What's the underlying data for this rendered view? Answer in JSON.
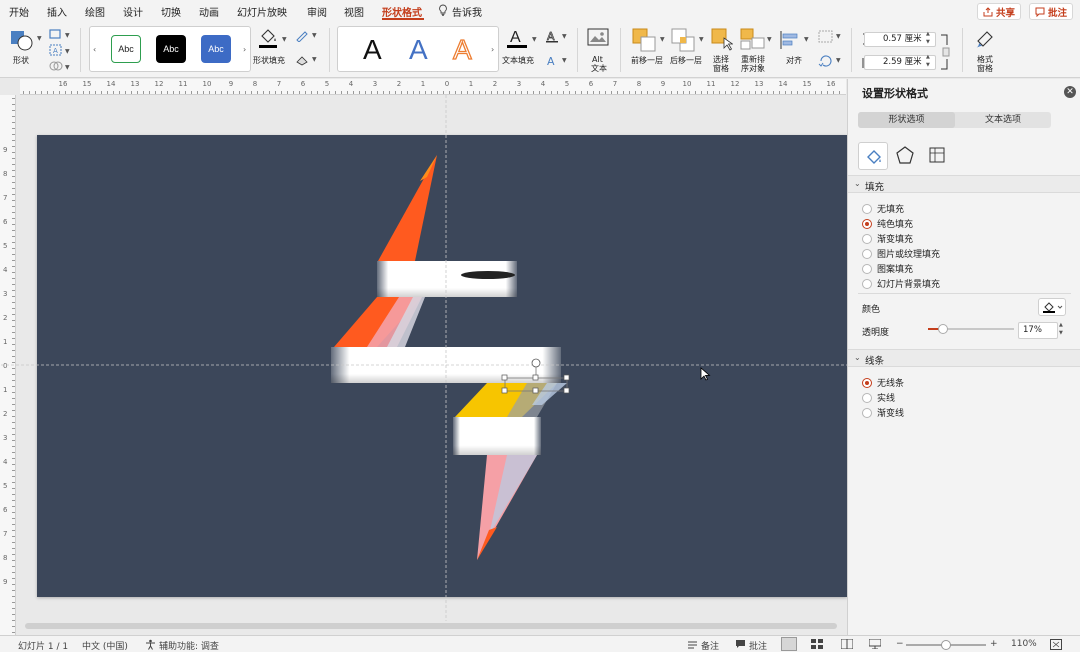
{
  "tabs": [
    {
      "label": "开始"
    },
    {
      "label": "插入"
    },
    {
      "label": "绘图"
    },
    {
      "label": "设计"
    },
    {
      "label": "切换"
    },
    {
      "label": "动画"
    },
    {
      "label": "幻灯片放映"
    },
    {
      "label": "审阅"
    },
    {
      "label": "视图"
    },
    {
      "label": "形状格式",
      "active": true
    },
    {
      "label": "告诉我"
    }
  ],
  "header": {
    "share_label": "共享",
    "comment_label": "批注"
  },
  "ribbon": {
    "shape_label": "形状",
    "style_swatches": [
      "Abc",
      "Abc",
      "Abc"
    ],
    "shape_fill_label": "形状填充",
    "wordart_letters": [
      "A",
      "A",
      "A"
    ],
    "text_fill_label": "文本填充",
    "alt_text_label_1": "Alt",
    "alt_text_label_2": "文本",
    "bring_forward_label": "前移一层",
    "send_backward_label": "后移一层",
    "selection_pane_label_1": "选择",
    "selection_pane_label_2": "窗格",
    "reorder_label_1": "重新排",
    "reorder_label_2": "序对象",
    "align_label": "对齐",
    "height_value": "0.57 厘米",
    "width_value": "2.59 厘米",
    "format_pane_label_1": "格式",
    "format_pane_label_2": "窗格"
  },
  "ruler": {
    "h_labels": [
      "16",
      "15",
      "14",
      "13",
      "12",
      "11",
      "10",
      "9",
      "8",
      "7",
      "6",
      "5",
      "4",
      "3",
      "2",
      "1",
      "0",
      "1",
      "2",
      "3",
      "4",
      "5",
      "6",
      "7",
      "8",
      "9",
      "10",
      "11",
      "12",
      "13",
      "14",
      "15",
      "16"
    ],
    "v_labels": [
      "9",
      "8",
      "7",
      "6",
      "5",
      "4",
      "3",
      "2",
      "1",
      "0",
      "1",
      "2",
      "3",
      "4",
      "5",
      "6",
      "7",
      "8",
      "9"
    ]
  },
  "panel": {
    "title": "设置形状格式",
    "tab_shape": "形状选项",
    "tab_text": "文本选项",
    "fill_section": "填充",
    "fill_options": [
      {
        "label": "无填充",
        "selected": false
      },
      {
        "label": "纯色填充",
        "selected": true
      },
      {
        "label": "渐变填充",
        "selected": false
      },
      {
        "label": "图片或纹理填充",
        "selected": false
      },
      {
        "label": "图案填充",
        "selected": false
      },
      {
        "label": "幻灯片背景填充",
        "selected": false
      }
    ],
    "color_label": "颜色",
    "transparency_label": "透明度",
    "transparency_value": "17%",
    "transparency_fraction": 0.17,
    "line_section": "线条",
    "line_options": [
      {
        "label": "无线条",
        "selected": true
      },
      {
        "label": "实线",
        "selected": false
      },
      {
        "label": "渐变线",
        "selected": false
      }
    ]
  },
  "status": {
    "slide_counter": "幻灯片 1 / 1",
    "language": "中文 (中国)",
    "accessibility": "辅助功能: 调查",
    "notes_label": "备注",
    "comments_label": "批注",
    "zoom_value": "110%",
    "zoom_fraction": 0.5
  },
  "colors": {
    "accent": "#c43e1c",
    "slide_bg": "#3c475a",
    "orange_red": "#ff5a1f",
    "pink": "#f5a0a6",
    "yellow": "#f7c500"
  }
}
